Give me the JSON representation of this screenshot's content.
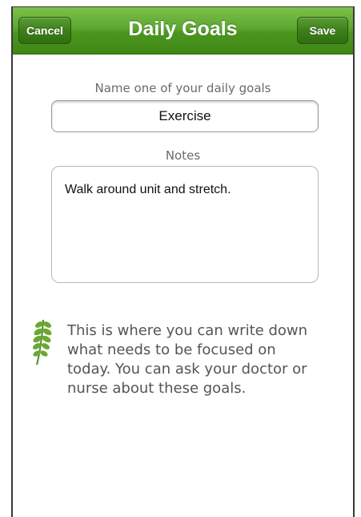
{
  "navbar": {
    "title": "Daily Goals",
    "cancel_label": "Cancel",
    "save_label": "Save"
  },
  "form": {
    "name_label": "Name one of your daily goals",
    "name_value": "Exercise",
    "notes_label": "Notes",
    "notes_value": "Walk around unit and stretch."
  },
  "help": {
    "icon": "leaf-icon",
    "text": "This is where you can write down what needs to be focused on today. You can ask your doctor or nurse about these goals."
  },
  "colors": {
    "navbar_green": "#4c961f",
    "button_green": "#3e7f1b",
    "leaf_green": "#6aa832",
    "label_gray": "#6b6b6b"
  }
}
